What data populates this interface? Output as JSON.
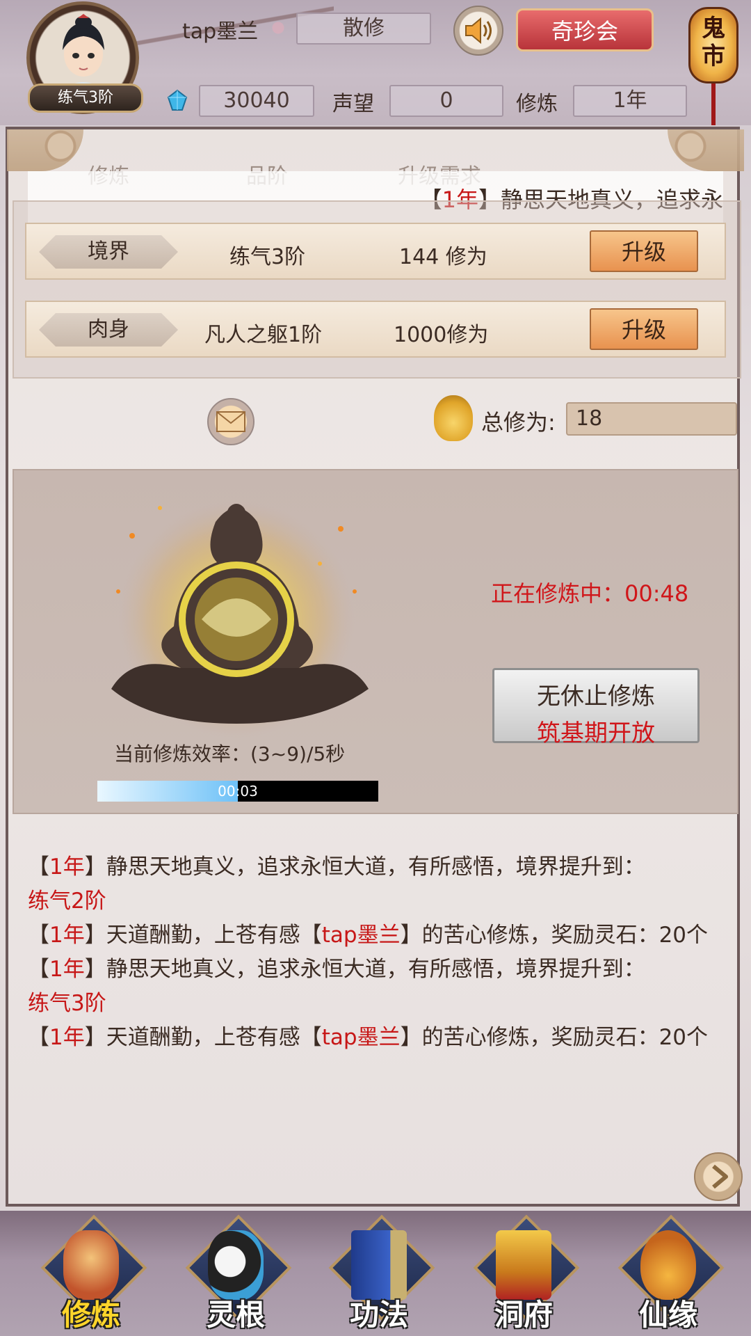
{
  "header": {
    "player_name": "tap墨兰",
    "sect": "散修",
    "level_badge": "练气3阶",
    "spirit_stones": "30040",
    "reputation_label": "声望",
    "reputation": "0",
    "cultivation_label": "修炼",
    "cultivation_time": "1年",
    "treasure_button": "奇珍会",
    "ghost_market": "鬼市"
  },
  "table": {
    "col_cultivate": "修炼",
    "col_grade": "品阶",
    "col_requirement": "升级需求"
  },
  "ticker": {
    "year": "1年",
    "text": "静思天地真义，追求永"
  },
  "stats": [
    {
      "label": "境界",
      "grade": "练气3阶",
      "requirement": "144 修为",
      "button": "升级"
    },
    {
      "label": "肉身",
      "grade": "凡人之躯1阶",
      "requirement": "1000修为",
      "button": "升级"
    }
  ],
  "total": {
    "label": "总修为:",
    "value": "18"
  },
  "cultivation": {
    "status": "正在修炼中：00:48",
    "endless_line1": "无休止修炼",
    "endless_line2": "筑基期开放",
    "efficiency": "当前修炼效率：(3~9)/5秒",
    "progress_text": "00:03",
    "progress_fraction": 0.5
  },
  "log": [
    {
      "year": "1年",
      "text": "静思天地真义，追求永恒大道，有所感悟，境界提升到：",
      "highlight": "练气2阶",
      "tail": ""
    },
    {
      "year": "1年",
      "text": "天道酬勤，上苍有感",
      "name": "tap墨兰",
      "tail": "的苦心修炼，奖励灵石：20个"
    },
    {
      "year": "1年",
      "text": "静思天地真义，追求永恒大道，有所感悟，境界提升到：",
      "highlight": "练气3阶",
      "tail": ""
    },
    {
      "year": "1年",
      "text": "天道酬勤，上苍有感",
      "name": "tap墨兰",
      "tail": "的苦心修炼，奖励灵石：20个"
    }
  ],
  "bracket_open": "【",
  "bracket_close": "】",
  "nav": [
    {
      "label": "修炼",
      "icon": "meditating-monk-icon",
      "active": true
    },
    {
      "label": "灵根",
      "icon": "yin-yang-sword-icon",
      "active": false
    },
    {
      "label": "功法",
      "icon": "scripture-book-icon",
      "active": false
    },
    {
      "label": "洞府",
      "icon": "pagoda-icon",
      "active": false
    },
    {
      "label": "仙缘",
      "icon": "gourd-icon",
      "active": false
    }
  ],
  "colors": {
    "accent_red": "#d0161a",
    "upgrade_orange": "#e8924f",
    "active_nav": "#ffd52a"
  }
}
